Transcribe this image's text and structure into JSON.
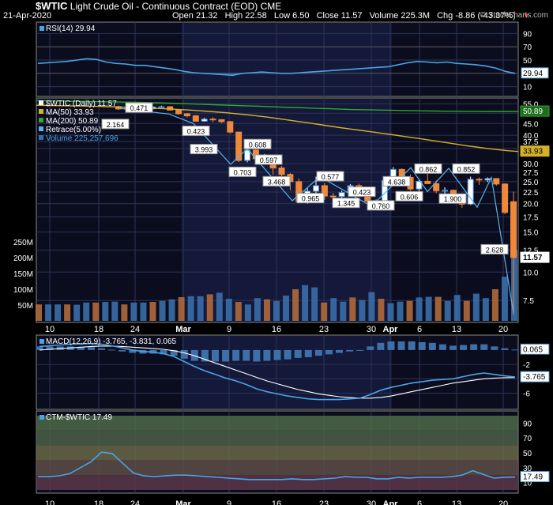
{
  "header": {
    "symbol": "$WTIC",
    "name": "Light Crude Oil - Continuous Contract (EOD)",
    "exchange": "CME",
    "date": "21-Apr-2020",
    "open_label": "Open",
    "open": "21.32",
    "high_label": "High",
    "high": "22.58",
    "low_label": "Low",
    "low": "6.50",
    "close_label": "Close",
    "close": "11.57",
    "volume_label": "Volume",
    "volume": "225.3M",
    "chg_label": "Chg",
    "chg": "-8.86 (-43.37%)",
    "brand": "© StockCharts.com"
  },
  "colors": {
    "up": "#4a90d9",
    "down": "#f0883c",
    "rsi": "#4aa3e8",
    "ma50": "#d4b12a",
    "ma200": "#2fa82f",
    "retrace": "#5ab4e8",
    "volume_up": "#3a6ea8",
    "volume_down": "#b06a3a",
    "macd_hist": "#3d6fa8",
    "macd_signal": "#ffffff",
    "panel_bg": "#0b0d1e"
  },
  "chart_data": [
    {
      "type": "line",
      "name": "RSI",
      "title": "RSI(14) 29.94",
      "ylim": [
        0,
        100
      ],
      "y_ticks": [
        "90",
        "70",
        "50",
        "30",
        "10"
      ],
      "last_value": "29.94",
      "values": [
        45,
        46,
        47,
        48,
        50,
        52,
        51,
        47,
        45,
        44,
        42,
        42,
        40,
        38,
        36,
        33,
        31,
        30,
        29,
        28,
        27,
        30,
        31,
        32,
        31,
        30,
        30,
        31,
        32,
        33,
        34,
        35,
        36,
        37,
        38,
        39,
        40,
        43,
        46,
        48,
        47,
        46,
        47,
        45,
        44,
        43,
        41,
        38,
        33,
        30
      ]
    },
    {
      "type": "candlestick",
      "name": "$WTIC (Daily)",
      "legend": [
        "$WTIC (Daily) 11.57",
        "MA(50) 33.93",
        "MA(200) 50.89",
        "Retrace(5.00%)",
        "Volume 225,257,696"
      ],
      "y_ticks": [
        "55.0",
        "50.0",
        "45.0",
        "40.0",
        "37.5",
        "35.0",
        "30.0",
        "27.5",
        "25.0",
        "22.5",
        "20.0",
        "17.5",
        "15.0",
        "12.5",
        "10.0",
        "7.5"
      ],
      "volume_ticks": [
        "250M",
        "200M",
        "150M",
        "100M",
        "50M"
      ],
      "last_labels": {
        "ma200": "50.89",
        "ma50": "33.93",
        "close": "11.57"
      },
      "retrace_labels": [
        "2.164",
        "0.471",
        "0.423",
        "3.993",
        "0.703",
        "0.608",
        "0.597",
        "3.468",
        "0.965",
        "0.577",
        "1.345",
        "0.423",
        "0.760",
        "4.638",
        "0.606",
        "0.862",
        "0.852",
        "1.900",
        "2.628"
      ],
      "candles": [
        [
          53.5,
          54.0,
          51.8,
          52.2
        ],
        [
          52.2,
          53.0,
          51.4,
          52.5
        ],
        [
          52.5,
          53.1,
          51.6,
          51.9
        ],
        [
          51.9,
          52.8,
          51.3,
          52.3
        ],
        [
          52.3,
          53.4,
          52.0,
          53.3
        ],
        [
          53.3,
          54.0,
          52.7,
          53.4
        ],
        [
          53.4,
          53.8,
          51.5,
          51.6
        ],
        [
          51.6,
          51.8,
          49.2,
          49.7
        ],
        [
          49.7,
          50.1,
          47.9,
          48.7
        ],
        [
          48.7,
          49.1,
          46.0,
          46.1
        ],
        [
          46.1,
          47.8,
          45.8,
          47.1
        ],
        [
          47.1,
          48.0,
          45.7,
          46.8
        ],
        [
          46.8,
          47.1,
          45.3,
          45.9
        ],
        [
          45.9,
          46.3,
          40.8,
          41.3
        ],
        [
          41.3,
          41.5,
          30.5,
          31.0
        ],
        [
          31.0,
          34.9,
          30.4,
          34.4
        ],
        [
          34.4,
          35.7,
          31.0,
          31.5
        ],
        [
          31.5,
          33.1,
          30.0,
          31.7
        ],
        [
          31.7,
          32.0,
          26.8,
          28.7
        ],
        [
          28.7,
          29.3,
          25.2,
          26.9
        ],
        [
          26.9,
          27.3,
          22.9,
          25.0
        ],
        [
          25.0,
          25.8,
          20.1,
          20.4
        ],
        [
          20.4,
          23.4,
          20.0,
          22.7
        ],
        [
          22.7,
          26.3,
          22.0,
          24.0
        ],
        [
          24.0,
          24.6,
          20.8,
          21.6
        ],
        [
          21.6,
          22.3,
          20.5,
          21.5
        ],
        [
          21.5,
          22.8,
          20.8,
          22.4
        ],
        [
          22.4,
          24.4,
          21.6,
          24.0
        ],
        [
          24.0,
          24.5,
          21.5,
          22.4
        ],
        [
          22.4,
          22.6,
          20.6,
          20.5
        ],
        [
          20.5,
          20.9,
          19.3,
          20.3
        ],
        [
          20.3,
          26.2,
          20.1,
          25.3
        ],
        [
          25.3,
          29.0,
          24.7,
          28.3
        ],
        [
          28.3,
          28.6,
          24.6,
          26.1
        ],
        [
          26.1,
          26.9,
          22.8,
          23.2
        ],
        [
          23.2,
          25.6,
          22.5,
          25.1
        ],
        [
          25.1,
          28.4,
          24.4,
          24.5
        ],
        [
          24.5,
          25.3,
          22.2,
          22.8
        ],
        [
          22.8,
          23.6,
          21.5,
          22.9
        ],
        [
          22.9,
          23.1,
          20.0,
          20.1
        ],
        [
          20.1,
          20.5,
          19.2,
          19.9
        ],
        [
          19.9,
          26.3,
          19.7,
          25.6
        ],
        [
          25.6,
          26.1,
          24.2,
          25.4
        ],
        [
          25.4,
          26.1,
          24.9,
          25.8
        ],
        [
          25.8,
          25.9,
          24.0,
          24.4
        ],
        [
          24.4,
          24.6,
          18.0,
          18.3
        ],
        [
          20.4,
          22.6,
          6.5,
          11.6
        ]
      ],
      "volume": [
        52,
        52,
        52,
        52,
        51,
        58,
        58,
        60,
        61,
        52,
        58,
        58,
        60,
        63,
        68,
        75,
        78,
        78,
        84,
        89,
        70,
        60,
        52,
        72,
        68,
        63,
        80,
        100,
        113,
        106,
        58,
        72,
        61,
        74,
        66,
        91,
        70,
        56,
        61,
        63,
        74,
        76,
        76,
        63,
        82,
        63,
        86,
        72,
        100,
        140,
        225
      ],
      "ma50": [
        54.2,
        54.1,
        54.0,
        53.9,
        53.8,
        53.7,
        53.6,
        53.4,
        53.2,
        53.0,
        52.8,
        52.6,
        52.4,
        52.1,
        51.8,
        51.5,
        51.1,
        50.7,
        50.3,
        49.8,
        49.3,
        48.7,
        48.1,
        47.4,
        46.7,
        46.0,
        45.3,
        44.6,
        43.9,
        43.2,
        42.6,
        42.0,
        41.4,
        40.8,
        40.2,
        39.6,
        39.0,
        38.4,
        37.8,
        37.2,
        36.6,
        36.0,
        35.5,
        35.0,
        34.6,
        34.2,
        33.93
      ],
      "ma200": [
        56.8,
        56.7,
        56.6,
        56.5,
        56.4,
        56.3,
        56.2,
        56.1,
        56.0,
        55.9,
        55.8,
        55.6,
        55.5,
        55.3,
        55.1,
        54.9,
        54.7,
        54.5,
        54.3,
        54.1,
        53.9,
        53.7,
        53.5,
        53.3,
        53.1,
        52.9,
        52.7,
        52.5,
        52.3,
        52.1,
        51.9,
        51.8,
        51.7,
        51.6,
        51.5,
        51.4,
        51.3,
        51.2,
        51.1,
        51.05,
        51.0,
        50.97,
        50.95,
        50.93,
        50.91,
        50.9,
        50.89
      ]
    },
    {
      "type": "histogram+line",
      "name": "MACD",
      "title": "MACD(12,26,9) -3.765, -3.831, 0.065",
      "y_ticks": [
        "-2",
        "-4",
        "-6"
      ],
      "last_labels": {
        "hist": "0.065",
        "macd": "-3.765"
      },
      "macd": [
        0.5,
        0.6,
        0.7,
        0.8,
        0.85,
        0.9,
        0.8,
        0.6,
        0.3,
        0.0,
        -0.2,
        -0.3,
        -0.5,
        -0.9,
        -1.6,
        -2.3,
        -2.9,
        -3.4,
        -3.9,
        -4.3,
        -4.8,
        -5.4,
        -5.8,
        -6.1,
        -6.4,
        -6.6,
        -6.8,
        -6.9,
        -6.9,
        -6.9,
        -6.8,
        -6.7,
        -6.2,
        -5.6,
        -5.2,
        -4.9,
        -4.6,
        -4.4,
        -4.2,
        -4.1,
        -4.0,
        -3.7,
        -3.4,
        -3.2,
        -3.4,
        -3.6,
        -3.765
      ],
      "signal": [
        0.0,
        0.1,
        0.2,
        0.3,
        0.4,
        0.5,
        0.55,
        0.55,
        0.5,
        0.4,
        0.3,
        0.2,
        0.1,
        -0.1,
        -0.4,
        -0.8,
        -1.3,
        -1.8,
        -2.3,
        -2.8,
        -3.3,
        -3.8,
        -4.3,
        -4.7,
        -5.1,
        -5.5,
        -5.8,
        -6.1,
        -6.3,
        -6.5,
        -6.6,
        -6.7,
        -6.7,
        -6.6,
        -6.4,
        -6.1,
        -5.8,
        -5.5,
        -5.2,
        -4.9,
        -4.6,
        -4.4,
        -4.2,
        -4.0,
        -3.9,
        -3.85,
        -3.831
      ],
      "hist": [
        0.5,
        0.5,
        0.5,
        0.5,
        0.45,
        0.4,
        0.25,
        0.05,
        -0.2,
        -0.4,
        -0.5,
        -0.5,
        -0.6,
        -0.8,
        -1.2,
        -1.5,
        -1.6,
        -1.6,
        -1.6,
        -1.5,
        -1.5,
        -1.6,
        -1.5,
        -1.4,
        -1.3,
        -1.1,
        -1.0,
        -0.8,
        -0.6,
        -0.4,
        -0.2,
        0.0,
        0.5,
        1.0,
        1.2,
        1.2,
        1.2,
        1.1,
        1.0,
        0.8,
        0.6,
        0.7,
        0.8,
        0.8,
        0.5,
        0.25,
        0.065
      ]
    },
    {
      "type": "line",
      "name": "CTM-$WTIC",
      "title": "CTM-$WTIC 17.49",
      "ylim": [
        0,
        100
      ],
      "y_ticks": [
        "90",
        "70",
        "50",
        "30",
        "10"
      ],
      "last_value": "17.49",
      "values": [
        18,
        18,
        19,
        22,
        30,
        38,
        51,
        49,
        36,
        23,
        19,
        18,
        19,
        20,
        20,
        19,
        18,
        17,
        16,
        15,
        14,
        14,
        14,
        14,
        15,
        14,
        14,
        15,
        16,
        18,
        17,
        17,
        15,
        15,
        17,
        16,
        17,
        17,
        17,
        18,
        20,
        26,
        21,
        16,
        17,
        17.49
      ]
    }
  ],
  "x_axis": {
    "labels": [
      "10",
      "18",
      "24",
      "Mar",
      "9",
      "16",
      "23",
      "30",
      "Apr",
      "6",
      "13",
      "20"
    ],
    "bold": [
      "Mar",
      "Apr"
    ]
  }
}
